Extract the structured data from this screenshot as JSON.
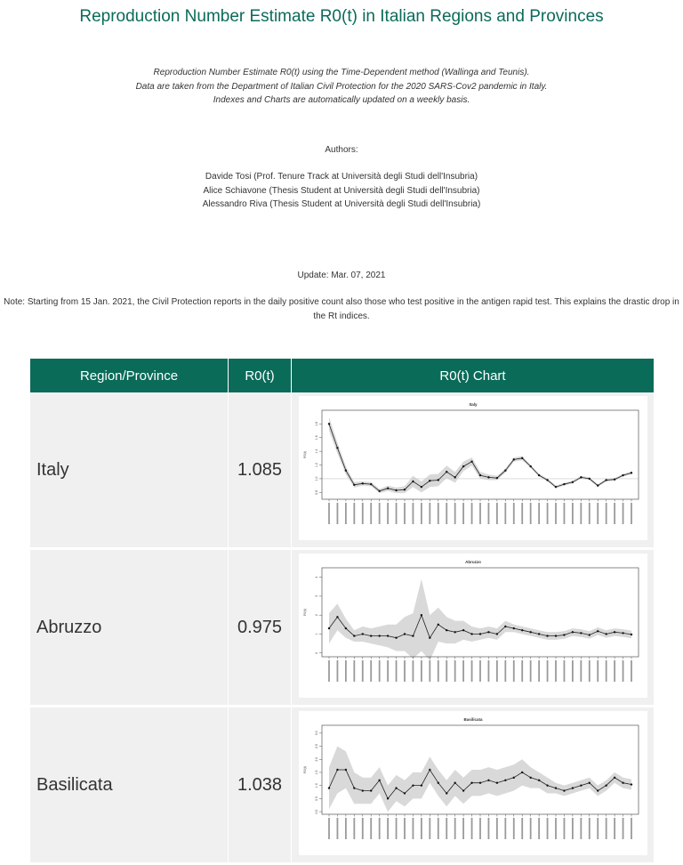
{
  "header": {
    "title": "Reproduction Number Estimate R0(t) in Italian Regions and Provinces",
    "description_lines": [
      "Reproduction Number Estimate R0(t) using the Time-Dependent method (Wallinga and Teunis).",
      "Data are taken from the Department of Italian Civil Protection for the 2020 SARS-Cov2 pandemic in Italy.",
      "Indexes and Charts are automatically updated on a weekly basis."
    ],
    "authors_heading": "Authors:",
    "authors": [
      "Davide Tosi (Prof. Tenure Track at Università degli Studi dell'Insubria)",
      "Alice Schiavone (Thesis Student at Università degli Studi dell'Insubria)",
      "Alessandro Riva (Thesis Student at Università degli Studi dell'Insubria)"
    ],
    "update": "Update: Mar. 07, 2021",
    "note": "Note: Starting from 15 Jan. 2021, the Civil Protection reports in the daily positive count also those who test positive in the antigen rapid test. This explains the drastic drop in the Rt indices."
  },
  "table": {
    "columns": [
      "Region/Province",
      "R0(t)",
      "R0(t) Chart"
    ],
    "rows": [
      {
        "name": "Italy",
        "r0": "1.085"
      },
      {
        "name": "Abruzzo",
        "r0": "0.975"
      },
      {
        "name": "Basilicata",
        "r0": "1.038"
      }
    ]
  },
  "chart_data": [
    {
      "type": "line",
      "title": "Italy",
      "ylabel": "R0(t)",
      "ylim": [
        0.7,
        2.0
      ],
      "yticks": [
        "0.8",
        "1.0",
        "1.2",
        "1.4",
        "1.6",
        "1.8"
      ],
      "reference_line": 1.0,
      "values": [
        1.8,
        1.45,
        1.12,
        0.91,
        0.93,
        0.92,
        0.82,
        0.86,
        0.83,
        0.84,
        0.96,
        0.88,
        0.97,
        0.98,
        1.1,
        1.02,
        1.18,
        1.25,
        1.05,
        1.02,
        1.01,
        1.12,
        1.28,
        1.3,
        1.18,
        1.05,
        0.98,
        0.88,
        0.92,
        0.95,
        1.02,
        1.0,
        0.9,
        0.98,
        0.99,
        1.05,
        1.085
      ],
      "band_halfwidth": [
        0.1,
        0.08,
        0.06,
        0.04,
        0.03,
        0.03,
        0.03,
        0.04,
        0.04,
        0.05,
        0.08,
        0.08,
        0.09,
        0.09,
        0.09,
        0.08,
        0.07,
        0.06,
        0.05,
        0.04,
        0.03,
        0.03,
        0.03,
        0.03,
        0.02,
        0.02,
        0.02,
        0.02,
        0.02,
        0.02,
        0.02,
        0.02,
        0.02,
        0.02,
        0.02,
        0.02,
        0.02
      ]
    },
    {
      "type": "line",
      "title": "Abruzzo",
      "ylabel": "R0(t)",
      "ylim": [
        -0.2,
        4.5
      ],
      "yticks": [
        "0",
        "1",
        "2",
        "3",
        "4"
      ],
      "values": [
        1.3,
        1.9,
        1.3,
        0.9,
        1.0,
        0.9,
        0.9,
        0.9,
        0.8,
        1.0,
        0.9,
        2.0,
        0.8,
        1.5,
        1.2,
        1.1,
        1.2,
        1.0,
        1.0,
        1.1,
        1.0,
        1.4,
        1.3,
        1.2,
        1.1,
        1.0,
        0.9,
        0.9,
        0.95,
        1.1,
        1.05,
        0.95,
        1.15,
        1.0,
        1.1,
        1.05,
        0.975
      ],
      "band_halfwidth": [
        0.8,
        0.7,
        0.5,
        0.3,
        0.4,
        0.4,
        0.5,
        0.6,
        0.7,
        0.9,
        1.2,
        1.9,
        1.2,
        0.9,
        0.7,
        0.6,
        0.5,
        0.4,
        0.3,
        0.3,
        0.3,
        0.3,
        0.2,
        0.2,
        0.2,
        0.2,
        0.2,
        0.2,
        0.2,
        0.2,
        0.2,
        0.2,
        0.2,
        0.2,
        0.2,
        0.2,
        0.2
      ]
    },
    {
      "type": "line",
      "title": "Basilicata",
      "ylabel": "R0(t)",
      "ylim": [
        -0.1,
        3.3
      ],
      "yticks": [
        "0.0",
        "0.5",
        "1.0",
        "1.5",
        "2.0",
        "2.5",
        "3.0"
      ],
      "values": [
        0.9,
        1.6,
        1.6,
        0.9,
        0.8,
        0.8,
        1.2,
        0.5,
        0.9,
        0.7,
        1.0,
        1.0,
        1.6,
        1.1,
        0.7,
        1.1,
        0.8,
        1.1,
        1.1,
        1.2,
        1.1,
        1.2,
        1.3,
        1.5,
        1.3,
        1.2,
        1.0,
        0.9,
        0.8,
        0.9,
        1.0,
        1.1,
        0.8,
        1.0,
        1.3,
        1.1,
        1.038
      ],
      "band_halfwidth": [
        0.8,
        0.9,
        0.7,
        0.6,
        0.5,
        0.5,
        0.5,
        0.5,
        0.5,
        0.5,
        0.5,
        0.5,
        0.5,
        0.5,
        0.5,
        0.5,
        0.5,
        0.5,
        0.5,
        0.5,
        0.5,
        0.5,
        0.5,
        0.5,
        0.4,
        0.3,
        0.3,
        0.2,
        0.2,
        0.2,
        0.2,
        0.2,
        0.2,
        0.2,
        0.2,
        0.2,
        0.2
      ]
    }
  ],
  "colors": {
    "header_bg": "#0b6b59",
    "title_text": "#0b6b59",
    "cell_bg": "#f0f0f0",
    "band": "#d9d9d9"
  }
}
